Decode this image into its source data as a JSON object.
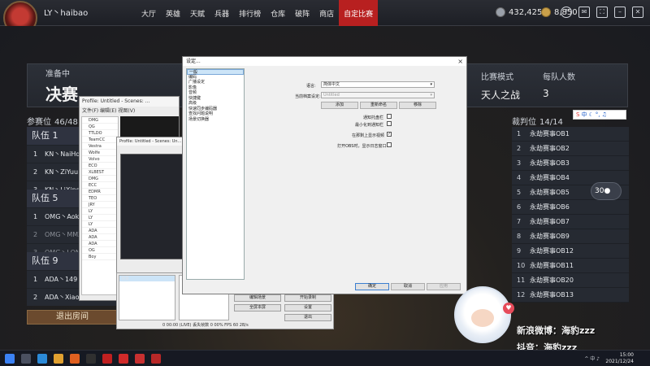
{
  "topbar": {
    "level": "50",
    "username": "LY丶haibao",
    "nav": [
      "大厅",
      "英雄",
      "天赋",
      "兵器",
      "排行榜",
      "仓库",
      "破阵",
      "商店",
      "自定比赛"
    ],
    "active_nav_index": 8,
    "silver": "432,425",
    "gold": "8,850",
    "icons": [
      "help-icon",
      "mail-icon",
      "fullscreen-icon",
      "minimize-icon",
      "close-icon"
    ]
  },
  "header": {
    "status": "准备中",
    "mode": "决赛",
    "match_mode_label": "比赛模式",
    "match_mode_value": "天人之战",
    "team_size_label": "每队人数",
    "team_size_value": "3"
  },
  "participants": {
    "label": "参赛位",
    "count": "46/48"
  },
  "referees": {
    "label": "裁判位",
    "count": "14/14"
  },
  "teams": [
    {
      "name": "队伍 1",
      "players": [
        "KN丶NaiHq",
        "KN丶ZiYuu",
        "KN丶LiXingHe"
      ]
    },
    {
      "name": "队伍 5",
      "players": [
        "OMG丶Aokizy",
        "OMG丶MMZ",
        "OMG丶LONGT"
      ]
    },
    {
      "name": "队伍 9",
      "players": [
        "ADA丶149",
        "ADA丶XiaoMin",
        ""
      ]
    }
  ],
  "referee_list": [
    "永劫赛事OB1",
    "永劫赛事OB2",
    "永劫赛事OB3",
    "永劫赛事OB4",
    "永劫赛事OB5",
    "永劫赛事OB6",
    "永劫赛事OB7",
    "永劫赛事OB9",
    "永劫赛事OB12",
    "永劫赛事OB11",
    "永劫赛事OB20",
    "永劫赛事OB13"
  ],
  "referee_numbers": [
    "1",
    "2",
    "3",
    "4",
    "5",
    "6",
    "7",
    "8",
    "9",
    "10",
    "11",
    "12"
  ],
  "leave_button": "退出房间",
  "float_ball": "30",
  "obs": {
    "title": "Profile: Untitled - Scenes: ...",
    "title2": "Profile: Untitled - Scenes: Un...",
    "menu": "文件(F)  编辑(E)  视图(V)",
    "scene_items": [
      "DMG",
      "QG",
      "TTLDO",
      "TeamCC",
      "Vestra",
      "Wolfe",
      "Volvo",
      "ECO",
      "XLBEST",
      "DMG",
      "ECC",
      "EDMR",
      "TEO",
      "JRY",
      "LY",
      "LY",
      "LY",
      "ADA",
      "ADA",
      "ADA",
      "OG",
      "Boy"
    ],
    "scenes_label": "场景",
    "sources_label": "来源",
    "edit_scene": "编辑场景",
    "start_record": "开始录制",
    "fullscreen": "全屏本屏",
    "settings": "设置",
    "exit": "退出",
    "status": "0  00:00 (LIVE)    丢失帧数  0  00%    FPS  60    2B/s"
  },
  "dialog": {
    "title": "设定...",
    "close": "×",
    "nav_items": [
      "一般",
      "编码",
      "广播设定",
      "影像",
      "音频",
      "快捷键",
      "高级",
      "快速同步编码器",
      "查找问题说明",
      "场景切换器"
    ],
    "selected_nav": 0,
    "language_label": "语言:",
    "language_value": "简体中文",
    "profile_label": "当前档案设定:",
    "profile_value": "Untitled",
    "btn_add": "添加",
    "btn_rename": "重新命名",
    "btn_remove": "移除",
    "notify_tray": "通知托盘栏",
    "minimize_tray": "最小化到通知栏",
    "show_preview": "在那剩上显示视频",
    "open_log": "打开OBS时，显示日志窗口",
    "ok": "确定",
    "cancel": "取消",
    "apply": "应用"
  },
  "ime": {
    "label": "中"
  },
  "streamer": {
    "heart": "♥",
    "weibo": "新浪微博：海豹zzz",
    "line2": "抖音：海豹zzz"
  },
  "taskbar": {
    "time": "15:00",
    "date": "2021/12/24",
    "tray": "^ 中 ♪"
  }
}
